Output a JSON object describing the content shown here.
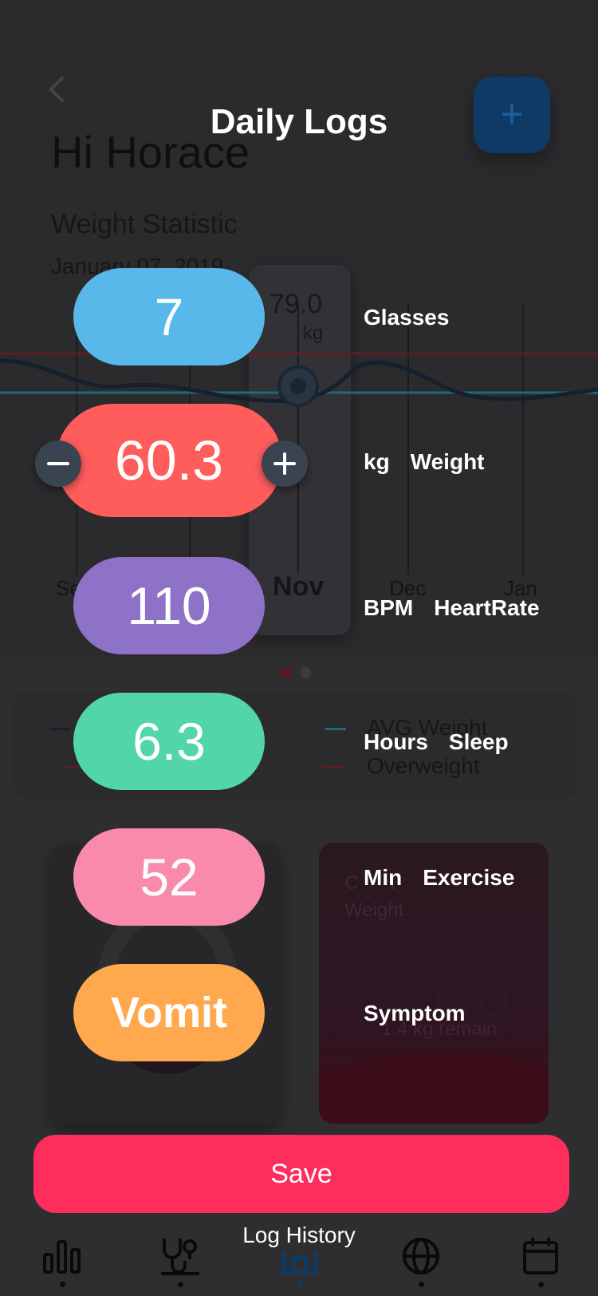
{
  "background": {
    "greeting": "Hi Horace",
    "weight_statistic_title": "Weight Statistic",
    "date": "January 07, 2019",
    "nov_card": {
      "value": "79.0",
      "unit": "kg"
    },
    "months": [
      "Se",
      "Nov",
      "Dec",
      "Jan"
    ],
    "legend": {
      "avg_weight": "AVG Weight",
      "overweight": "Overweight"
    },
    "current_weight": {
      "label": "Current Weight",
      "label_visible": "C      t\nWeight",
      "value": "81.0",
      "remain": "1.4 kg remain"
    },
    "colors": {
      "avg_line": "#1d6a7a",
      "overweight_line": "#5a1f22",
      "weight_curve": "#14202e"
    }
  },
  "modal": {
    "title": "Daily Logs",
    "rows": [
      {
        "key": "glasses",
        "value": "7",
        "unit": "",
        "label": "Glasses",
        "color": "#58b8ea"
      },
      {
        "key": "weight",
        "value": "60.3",
        "unit": "kg",
        "label": "Weight",
        "color": "#ff5c5c"
      },
      {
        "key": "heartrate",
        "value": "110",
        "unit": "BPM",
        "label": "HeartRate",
        "color": "#8e72c8"
      },
      {
        "key": "sleep",
        "value": "6.3",
        "unit": "Hours",
        "label": "Sleep",
        "color": "#52d6a8"
      },
      {
        "key": "exercise",
        "value": "52",
        "unit": "Min",
        "label": "Exercise",
        "color": "#f98aab"
      },
      {
        "key": "symptom",
        "value": "Vomit",
        "unit": "",
        "label": "Symptom",
        "color": "#ffa84d"
      }
    ],
    "save_label": "Save",
    "log_history_label": "Log History"
  },
  "tabbar": {
    "icons": [
      "bar-chart-icon",
      "stethoscope-icon",
      "home-icon",
      "globe-icon",
      "calendar-icon"
    ],
    "active_index": 2
  }
}
